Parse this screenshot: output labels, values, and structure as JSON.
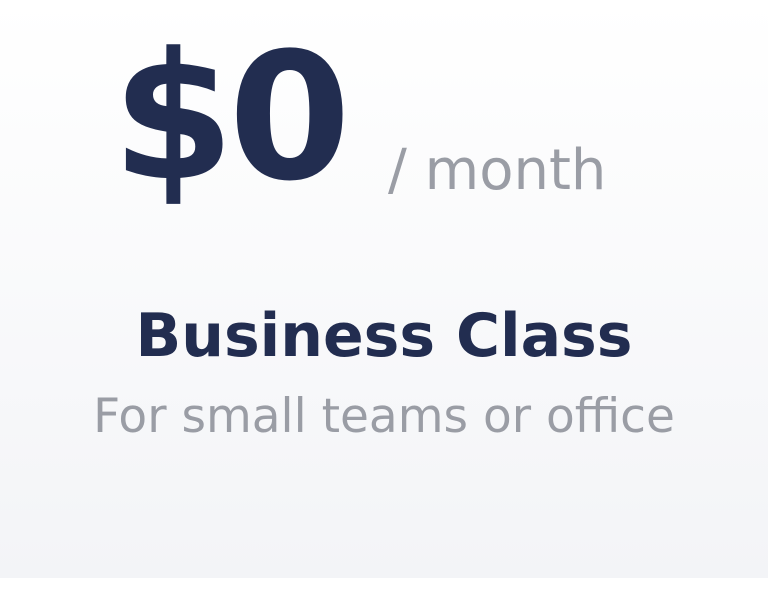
{
  "pricing_card": {
    "price": {
      "amount": "$0",
      "period": "/ month"
    },
    "plan_name": "Business Class",
    "plan_description": "For small teams or office"
  },
  "colors": {
    "primary_text": "#222d50",
    "muted_text": "#9a9da5",
    "card_background_top": "#ffffff",
    "card_background_bottom": "#f3f4f7"
  }
}
